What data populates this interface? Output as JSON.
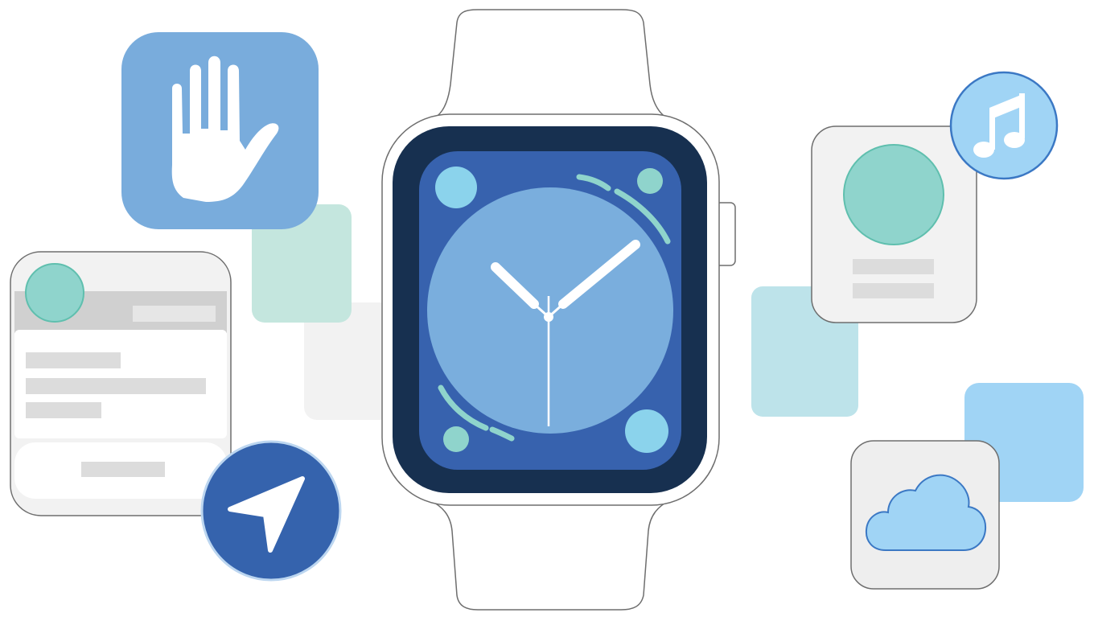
{
  "title": "",
  "colors": {
    "background": "#ffffff",
    "outline": "#6e6e6e",
    "watch_bezel": "#173050",
    "watch_screen": "#3762ae",
    "dial_light": "#7aaedd",
    "complication_cyan": "#8bd3ec",
    "complication_mint": "#8fd4cc",
    "card_gray": "#f2f2f2",
    "bar_gray": "#dcdcdc",
    "tile_mint": "#c4e6de",
    "tile_aqua": "#bde3ea",
    "tile_sky": "#a0d4f5",
    "tile_blue": "#79acdc",
    "nav_blue": "#3563ad"
  },
  "icons": [
    "hand-icon",
    "location-arrow-icon",
    "music-note-icon",
    "cloud-icon"
  ]
}
